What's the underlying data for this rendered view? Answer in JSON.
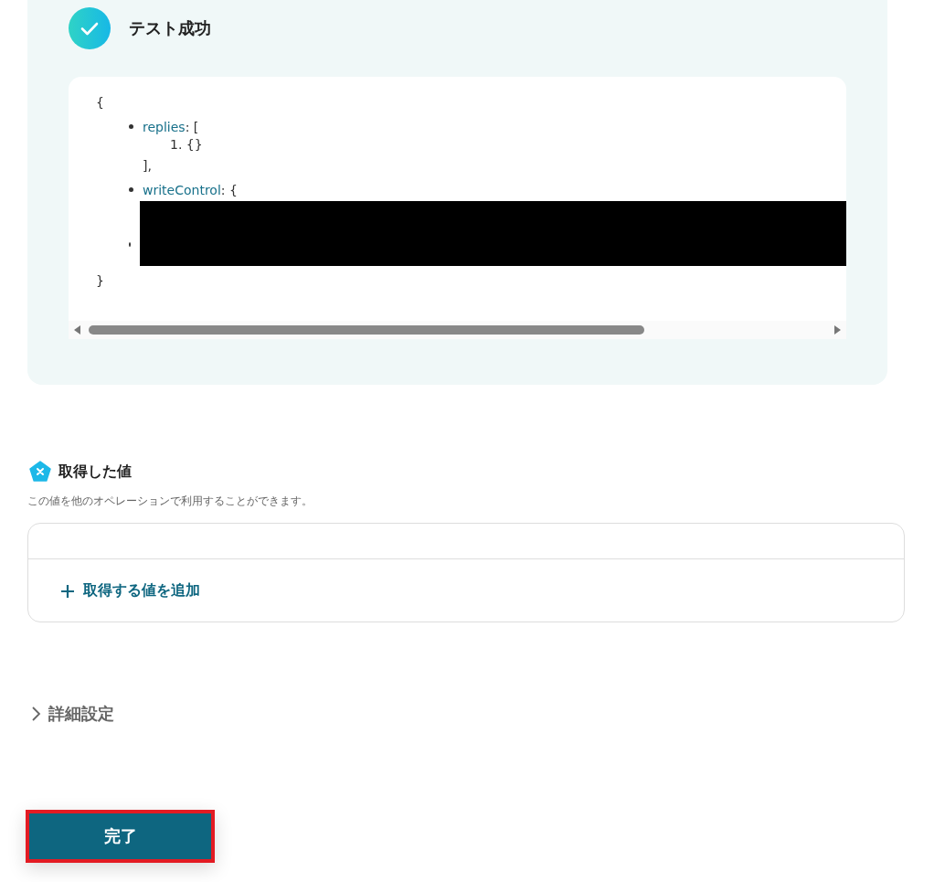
{
  "result": {
    "title": "テスト成功",
    "code": {
      "open": "{",
      "close": "}",
      "items": [
        {
          "key": "replies",
          "suffix": ": [",
          "children": [
            {
              "marker": "1.",
              "text": "{}"
            }
          ],
          "end": "],"
        },
        {
          "key": "writeControl",
          "suffix": ": {"
        }
      ]
    }
  },
  "output_values": {
    "title": "取得した値",
    "description": "この値を他のオペレーションで利用することができます。",
    "add_button": "取得する値を追加"
  },
  "advanced": {
    "label": "詳細設定",
    "expanded": false
  },
  "done_button": "完了"
}
